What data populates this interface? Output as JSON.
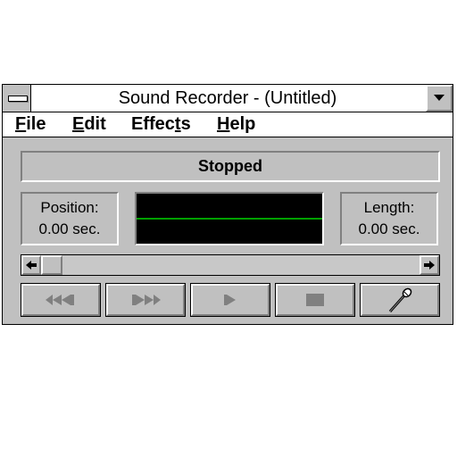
{
  "window": {
    "title": "Sound Recorder - (Untitled)"
  },
  "menu": {
    "items": [
      {
        "label": "File",
        "mnemonic_index": 0
      },
      {
        "label": "Edit",
        "mnemonic_index": 0
      },
      {
        "label": "Effects",
        "mnemonic_index": 5
      },
      {
        "label": "Help",
        "mnemonic_index": 0
      }
    ]
  },
  "status": {
    "text": "Stopped"
  },
  "position": {
    "label": "Position:",
    "value": "0.00 sec."
  },
  "length": {
    "label": "Length:",
    "value": "0.00 sec."
  },
  "scrollbar": {
    "position_fraction": 0.0
  },
  "controls": [
    {
      "name": "rewind-button",
      "icon": "rewind-icon"
    },
    {
      "name": "fast-forward-button",
      "icon": "fast-forward-icon"
    },
    {
      "name": "play-button",
      "icon": "play-icon"
    },
    {
      "name": "stop-button",
      "icon": "stop-icon"
    },
    {
      "name": "record-button",
      "icon": "microphone-icon"
    }
  ],
  "colors": {
    "face": "#c0c0c0",
    "waveform_bg": "#000000",
    "waveform_line": "#00a000"
  }
}
